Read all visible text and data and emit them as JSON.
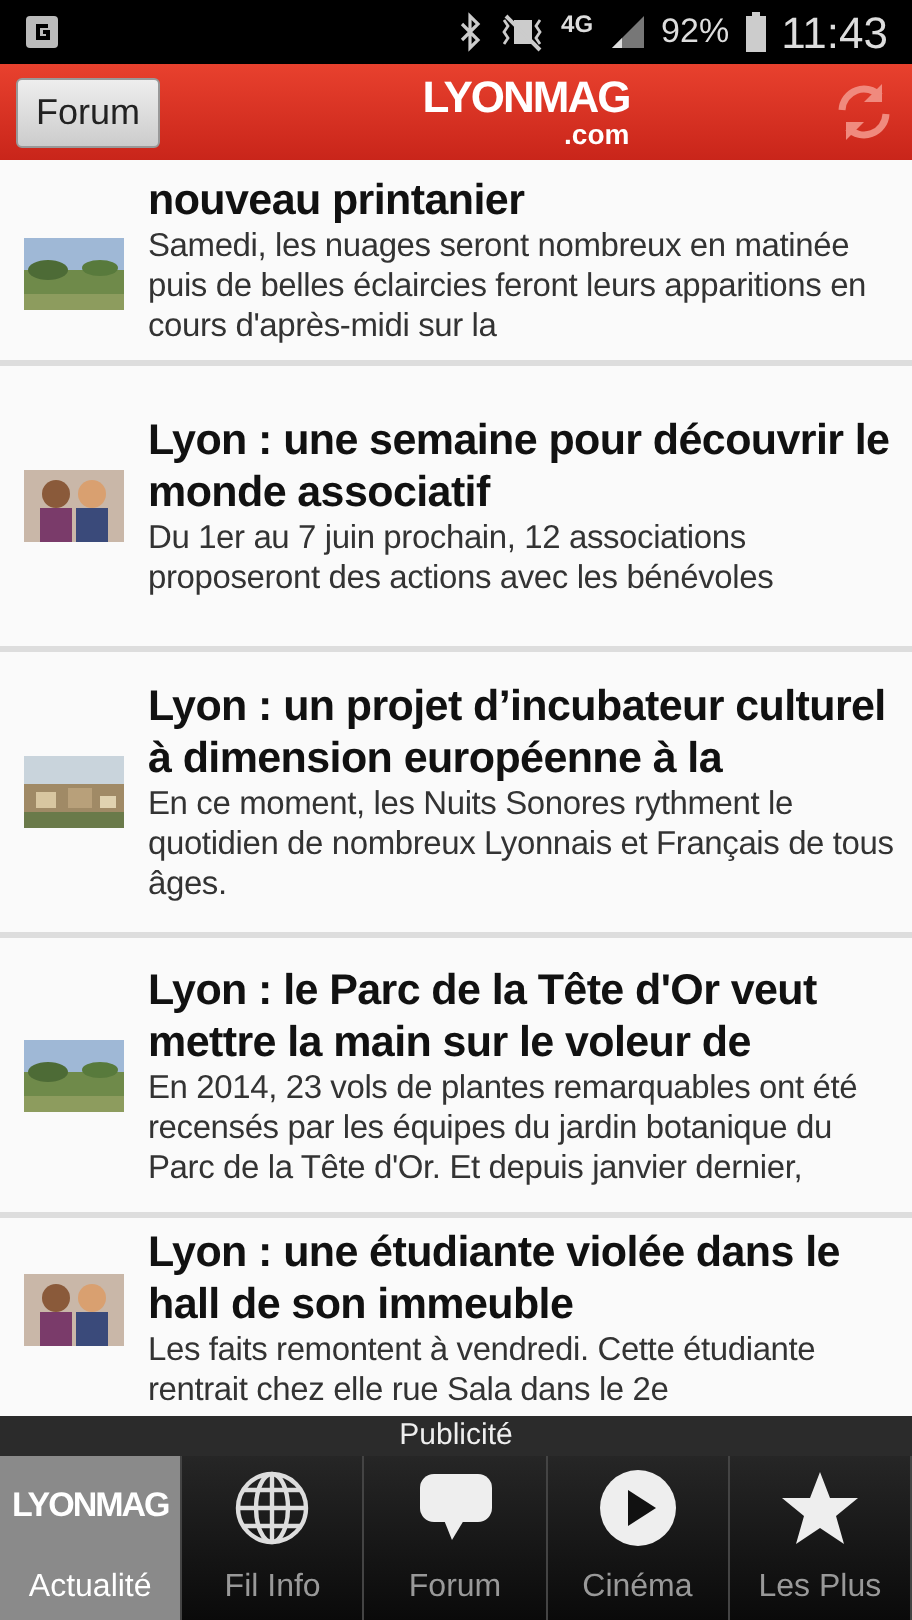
{
  "status_bar": {
    "network": "4G",
    "battery": "92%",
    "time": "11:43"
  },
  "header": {
    "button": "Forum",
    "logo": "LYONMAG",
    "logo_suffix": ".com"
  },
  "articles": [
    {
      "title": "nouveau printanier",
      "summary": "Samedi, les nuages seront nombreux en matinée puis de belles éclaircies feront leurs apparitions en cours d'après-midi sur la"
    },
    {
      "title": "Lyon : une semaine pour découvrir le monde associatif",
      "summary": "Du 1er au 7 juin prochain, 12 associations proposeront des actions avec les bénévoles"
    },
    {
      "title": "Lyon : un projet d’incubateur culturel à dimension européenne à la",
      "summary": "En ce moment, les Nuits Sonores rythment le quotidien de nombreux Lyonnais et Français de tous âges."
    },
    {
      "title": "Lyon : le Parc de la Tête d'Or veut mettre la main sur le voleur de",
      "summary": "En 2014, 23 vols de plantes remarquables ont été recensés par les équipes du jardin botanique du Parc de la Tête d'Or. Et depuis janvier dernier,"
    },
    {
      "title": "Lyon : une étudiante violée dans le hall de son immeuble",
      "summary": "Les faits remontent à vendredi. Cette étudiante rentrait chez elle rue Sala dans le 2e"
    }
  ],
  "ad_label": "Publicité",
  "tabs": [
    {
      "kind": "logo",
      "logo": "LYONMAG",
      "label": "Actualité",
      "selected": true
    },
    {
      "kind": "globe",
      "label": "Fil Info",
      "selected": false
    },
    {
      "kind": "bubble",
      "label": "Forum",
      "selected": false
    },
    {
      "kind": "play",
      "label": "Cinéma",
      "selected": false
    },
    {
      "kind": "star",
      "label": "Les Plus",
      "selected": false
    }
  ]
}
